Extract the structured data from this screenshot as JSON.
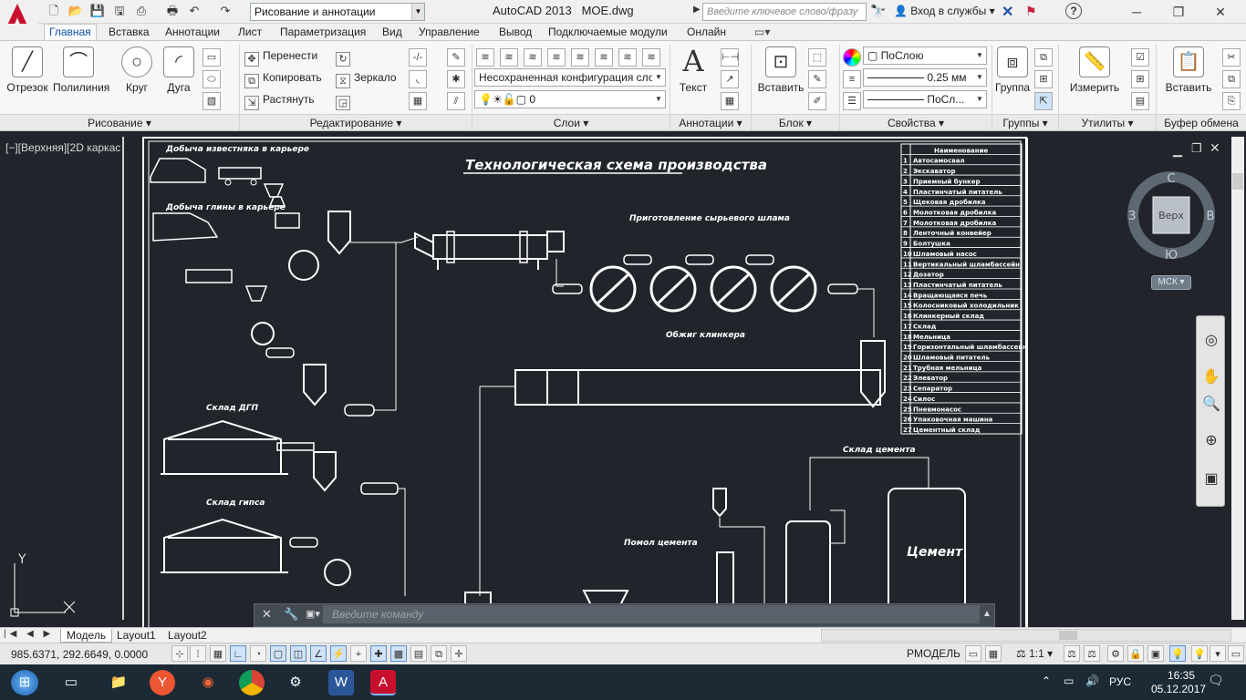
{
  "window": {
    "app": "AutoCAD 2013",
    "file": "MOE.dwg",
    "workspace": "Рисование и аннотации",
    "search_placeholder": "Введите ключевое слово/фразу",
    "signin": "Вход в службы"
  },
  "tabs": [
    "Главная",
    "Вставка",
    "Аннотации",
    "Лист",
    "Параметризация",
    "Вид",
    "Управление",
    "Вывод",
    "Подключаемые модули",
    "Онлайн"
  ],
  "ribbon": {
    "draw": {
      "line": "Отрезок",
      "polyline": "Полилиния",
      "circle": "Круг",
      "arc": "Дуга",
      "title": "Рисование"
    },
    "modify": {
      "move": "Перенести",
      "copy": "Копировать",
      "stretch": "Растянуть",
      "mirror": "Зеркало",
      "title": "Редактирование"
    },
    "layers": {
      "state": "Несохраненная конфигурация сло",
      "current": "0",
      "title": "Слои"
    },
    "annotation": {
      "text": "Текст",
      "title": "Аннотации"
    },
    "block": {
      "insert": "Вставить",
      "title": "Блок"
    },
    "properties": {
      "color": "ПоСлою",
      "lineweight": "0.25 мм",
      "linetype": "ПоСл...",
      "title": "Свойства"
    },
    "groups": {
      "group": "Группа",
      "title": "Группы"
    },
    "utilities": {
      "measure": "Измерить",
      "title": "Утилиты"
    },
    "clipboard": {
      "paste": "Вставить",
      "title": "Буфер обмена"
    }
  },
  "viewport": {
    "label": "[−][Верхняя][2D каркас",
    "viewcube": {
      "top": "Верх",
      "n": "С",
      "s": "Ю",
      "w": "З",
      "e": "В",
      "ucs": "МСК"
    },
    "axis_y": "Y"
  },
  "drawing": {
    "title": "Технологическая схема производства",
    "labels": {
      "limestone": "Добыча известняка в карьере",
      "clay": "Добыча глины в карьере",
      "raw_mix": "Приготовление сырьевого шлама",
      "kiln": "Обжиг клинкера",
      "gypsum": "Склад гипса",
      "slag": "Склад ДГП",
      "cement_store": "Склад цемента",
      "cement_silo": "Цемент",
      "cement_pack": "Помол цемента"
    },
    "legend_header": "Наименование",
    "legend_items": [
      "Автосамосвал",
      "Экскаватор",
      "Приемный бункер",
      "Пластинчатый питатель",
      "Щековая дробилка",
      "Молотковая дробилка",
      "Молотковая дробилка",
      "Ленточный конвейер",
      "Болтушка",
      "Шламовый насос",
      "Вертикальный шламбассейн",
      "Дозатор",
      "Пластинчатый питатель",
      "Вращающаяся печь",
      "Колосниковый холодильник",
      "Клинкерный склад",
      "Склад",
      "Мельница",
      "Горизонтальный шламбассейн",
      "Шламовый питатель",
      "Трубная мельница",
      "Элеватор",
      "Сепаратор",
      "Силос",
      "Пневмонасос",
      "Упаковочная машина",
      "Цементный склад"
    ]
  },
  "command": {
    "placeholder": "Введите  команду"
  },
  "layout_tabs": [
    "Модель",
    "Layout1",
    "Layout2"
  ],
  "status": {
    "coords": "985.6371, 292.6649, 0.0000",
    "space": "PМОДЕЛЬ",
    "scale": "1:1"
  },
  "taskbar": {
    "lang": "РУС",
    "time": "16:35",
    "date": "05.12.2017"
  }
}
